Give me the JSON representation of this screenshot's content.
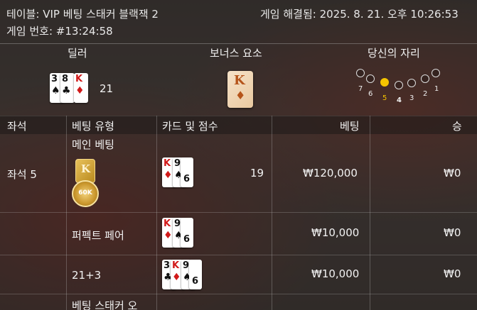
{
  "header": {
    "title": "테이블: VIP 베팅 스태커 블랙잭 2",
    "game_id": "게임 번호: #13:24:58",
    "resolved": "게임 해결됨: 2025. 8. 21. 오후 10:26:53"
  },
  "top_section": {
    "dealer_label": "딜러",
    "bonus_label": "보너스 요소",
    "your_seat_label": "당신의 자리",
    "dealer_cards": [
      {
        "rank": "3",
        "suit": "♠",
        "color": "black"
      },
      {
        "rank": "8",
        "suit": "♣",
        "color": "black"
      },
      {
        "rank": "K",
        "suit": "♦",
        "color": "red"
      }
    ],
    "dealer_score": "21",
    "bonus_card": {
      "rank": "K",
      "suit": "♦"
    },
    "seats": [
      "7",
      "6",
      "5",
      "4",
      "3",
      "2",
      "1"
    ],
    "active_seat": "5"
  },
  "table": {
    "headers": {
      "seat": "좌석",
      "bet_type": "베팅 유형",
      "cards": "카드 및 점수",
      "bet": "베팅",
      "win": "승"
    },
    "seat_label": "좌석 5",
    "rows": [
      {
        "bet_type": "메인 베팅",
        "cards": [
          {
            "rank": "K",
            "suit": "♦",
            "color": "red"
          },
          {
            "rank": "9",
            "suit": "♠",
            "color": "black"
          }
        ],
        "extra_card": {
          "rank": "6"
        },
        "score": "19",
        "bet": "₩120,000",
        "win": "₩0",
        "chip_label": "60K",
        "bonus_badge": "K"
      },
      {
        "bet_type": "퍼펙트 페어",
        "cards": [
          {
            "rank": "K",
            "suit": "♦",
            "color": "red"
          },
          {
            "rank": "9",
            "suit": "♠",
            "color": "black"
          }
        ],
        "extra_card": {
          "rank": "6"
        },
        "score": "",
        "bet": "₩10,000",
        "win": "₩0"
      },
      {
        "bet_type": "21+3",
        "cards": [
          {
            "rank": "3",
            "suit": "♣",
            "color": "black"
          },
          {
            "rank": "K",
            "suit": "♦",
            "color": "red"
          },
          {
            "rank": "9",
            "suit": "♠",
            "color": "black"
          }
        ],
        "extra_card": {
          "rank": "6"
        },
        "score": "",
        "bet": "₩10,000",
        "win": "₩0"
      },
      {
        "bet_type": "베팅 스태커 오",
        "cards": [],
        "score": "",
        "bet": "",
        "win": ""
      }
    ]
  },
  "colors": {
    "accent": "#f5c400",
    "card_red": "#d11a1a"
  }
}
